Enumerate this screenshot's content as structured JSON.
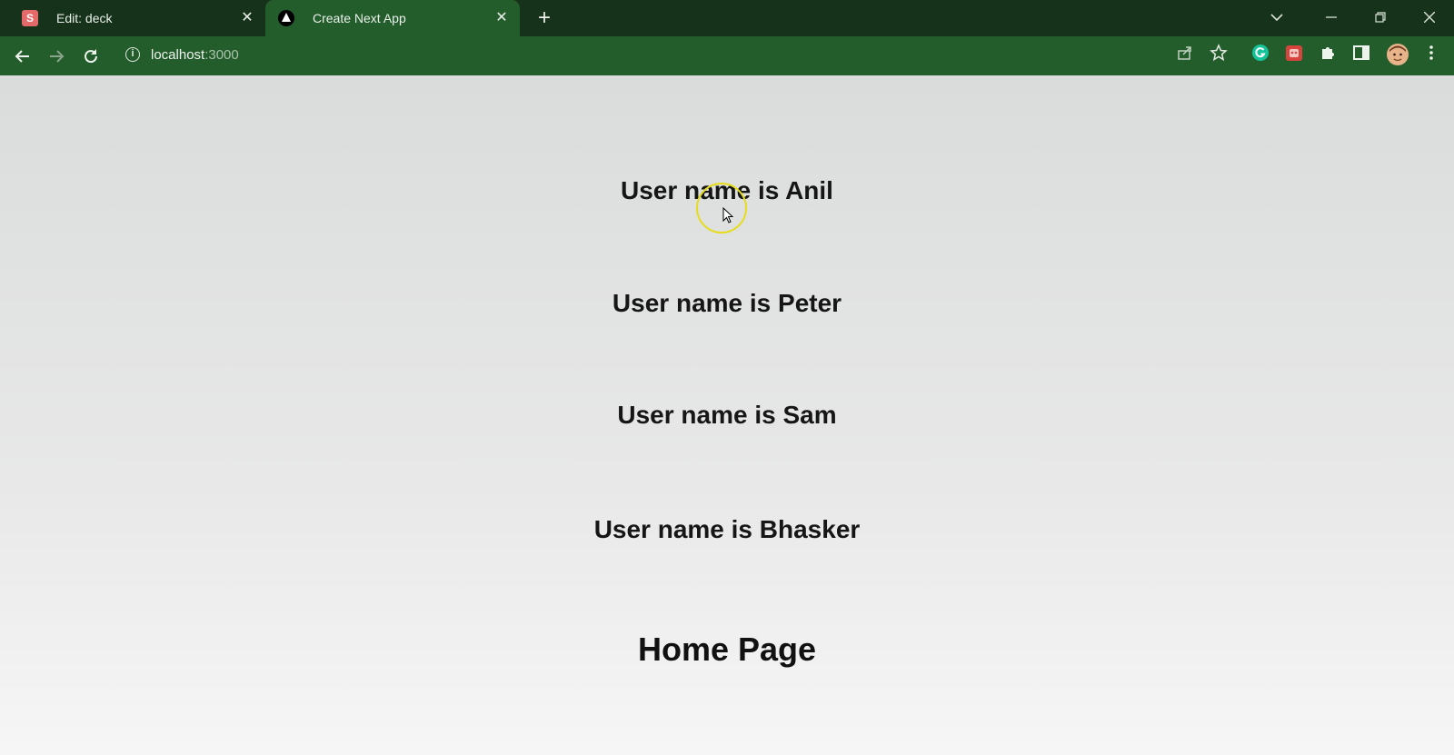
{
  "browser": {
    "tabs": [
      {
        "title": "Edit: deck",
        "favicon": "S",
        "active": false
      },
      {
        "title": "Create Next App",
        "active": true
      }
    ],
    "new_tab_label": "+",
    "address": {
      "host": "localhost",
      "port": ":3000"
    }
  },
  "page": {
    "users": [
      "User name is Anil",
      "User name is Peter",
      "User name is Sam",
      "User name is Bhasker"
    ],
    "title": "Home Page"
  },
  "colors": {
    "tabbar": "#17321a",
    "toolbar": "#245d2c",
    "page_background": "#e4e5e5",
    "cursor_highlight": "#e6dc1c"
  }
}
